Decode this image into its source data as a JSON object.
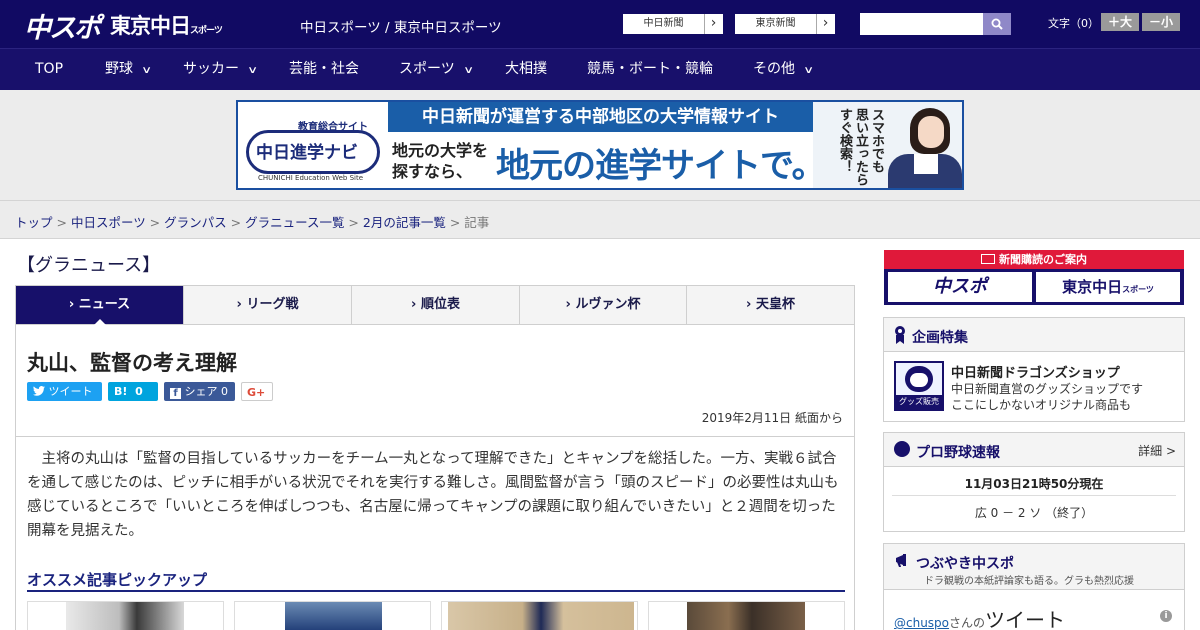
{
  "header": {
    "logo_chuspo": "中スポ",
    "logo_tokyo": "東京中日",
    "logo_tokyo_small": "スポーツ",
    "site_title": "中日スポーツ / 東京中日スポーツ",
    "links": [
      {
        "label": "中日新聞",
        "arrow": "›"
      },
      {
        "label": "東京新聞",
        "arrow": "›"
      }
    ],
    "search_placeholder": "",
    "font_size_label": "文字（0）",
    "font_bigger": "＋大",
    "font_smaller": "－小"
  },
  "nav": {
    "items": [
      {
        "label": "TOP",
        "has_menu": false
      },
      {
        "label": "野球",
        "has_menu": true
      },
      {
        "label": "サッカー",
        "has_menu": true
      },
      {
        "label": "芸能・社会",
        "has_menu": false
      },
      {
        "label": "スポーツ",
        "has_menu": true
      },
      {
        "label": "大相撲",
        "has_menu": false
      },
      {
        "label": "競馬・ボート・競輪",
        "has_menu": false
      },
      {
        "label": "その他",
        "has_menu": true
      }
    ],
    "chevron": "∨"
  },
  "banner": {
    "kyoiku": "教育総合サイト",
    "logo": "中日進学ナビ",
    "edu": "CHUNICHI Education Web Site",
    "top_text": "中日新聞が運営する中部地区の大学情報サイト",
    "small_text_1": "地元の大学を",
    "small_text_2": "探すなら、",
    "big_text": "地元の進学サイトで。",
    "vertical_text": "スマホでも 思い立ったら すぐ検索！"
  },
  "breadcrumb": {
    "items": [
      "トップ",
      "中日スポーツ",
      "グランパス",
      "グラニュース一覧",
      "2月の記事一覧"
    ],
    "current": "記事",
    "sep": " > "
  },
  "category_title": "【グラニュース】",
  "tabs": [
    {
      "label": "ニュース",
      "active": true
    },
    {
      "label": "リーグ戦",
      "active": false
    },
    {
      "label": "順位表",
      "active": false
    },
    {
      "label": "ルヴァン杯",
      "active": false
    },
    {
      "label": "天皇杯",
      "active": false
    }
  ],
  "tab_marker": "›",
  "article": {
    "headline": "丸山、監督の考え理解",
    "share": {
      "tweet": "ツイート",
      "hatena_label": "B!",
      "hatena_count": "0",
      "facebook": "シェア",
      "facebook_count": "0",
      "gplus": "G+"
    },
    "date": "2019年2月11日 紙面から",
    "body": "　主将の丸山は「監督の目指しているサッカーをチーム一丸となって理解できた」とキャンプを総括した。一方、実戦６試合を通して感じたのは、ピッチに相手がいる状況でそれを実行する難しさ。風間監督が言う「頭のスピード」の必要性は丸山も感じているところで「いいところを伸ばしつつも、名古屋に帰ってキャンプの課題に取り組んでいきたい」と２週間を切った開幕を見据えた。",
    "pickup_title": "オススメ記事ピックアップ"
  },
  "sidebar": {
    "subscribe_head": "新聞購読のご案内",
    "subscribe_chuspo": "中スポ",
    "subscribe_tokyo": "東京中日",
    "subscribe_tokyo_small": "スポーツ",
    "feature_title": "企画特集",
    "shop_name": "中日新聞ドラゴンズショップ",
    "shop_desc_1": "中日新聞直営のグッズショップです",
    "shop_desc_2": "ここにしかないオリジナル商品も",
    "shop_tag": "グッズ販売中",
    "baseball_title": "プロ野球速報",
    "baseball_detail": "詳細 >",
    "score_time": "11月03日21時50分現在",
    "score_line": "広 0 － 2 ソ （終了）",
    "twitter_title": "つぶやき中スポ",
    "twitter_sub": "ドラ観戦の本紙評論家も語る。グラも熱烈応援",
    "twitter_user": "@chuspo",
    "twitter_san": "さんの",
    "twitter_tweet": "ツイート",
    "info": "i"
  },
  "colors": {
    "header_bg": "#110a63",
    "nav_bg": "#18106b",
    "accent_red": "#e0193a",
    "banner_blue": "#1a5ea8",
    "twitter": "#1da1f2",
    "hatena": "#00a4de",
    "facebook": "#3b5998"
  }
}
